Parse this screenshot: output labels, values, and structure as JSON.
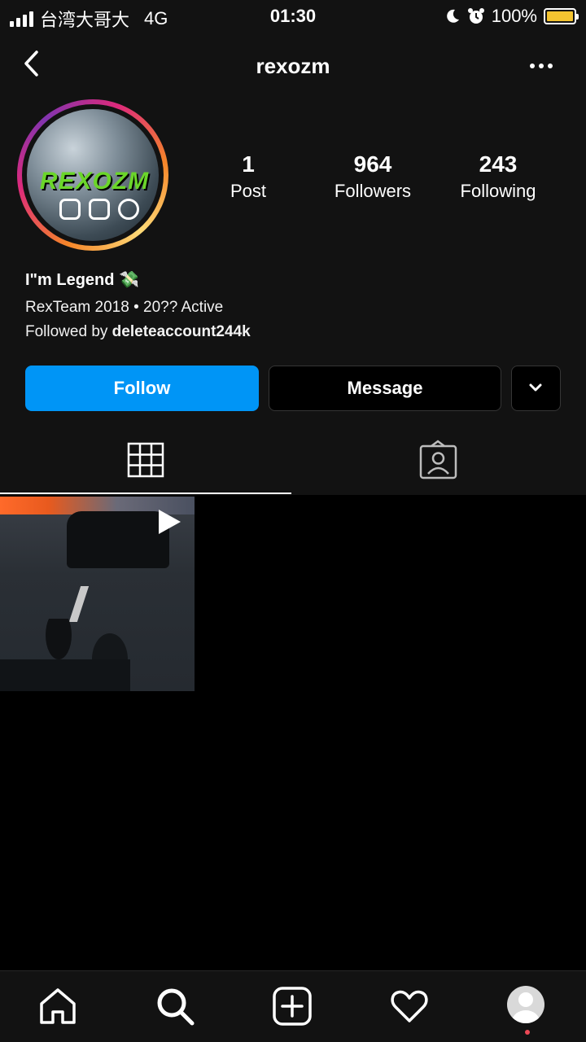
{
  "status_bar": {
    "carrier": "台湾大哥大",
    "network": "4G",
    "time": "01:30",
    "battery": "100%",
    "battery_fill_fraction": 1.0
  },
  "header": {
    "username": "rexozm",
    "back_icon": "chevron-left-icon",
    "more_icon": "ellipsis-icon"
  },
  "profile": {
    "avatar_logo_text": "REXOZM",
    "stats": [
      {
        "value": "1",
        "label": "Post"
      },
      {
        "value": "964",
        "label": "Followers"
      },
      {
        "value": "243",
        "label": "Following"
      }
    ],
    "bio": {
      "name": "I\"m Legend 💸",
      "line": "RexTeam 2018 • 20?? Active",
      "followed_by_prefix": "Followed by",
      "followed_by_user": "deleteaccount244k"
    }
  },
  "actions": {
    "follow_label": "Follow",
    "message_label": "Message",
    "dropdown_icon": "chevron-down-icon"
  },
  "tabs": [
    {
      "name": "grid",
      "icon": "grid-icon",
      "active": true
    },
    {
      "name": "tagged",
      "icon": "tagged-person-icon",
      "active": false
    }
  ],
  "posts": [
    {
      "type": "video",
      "icon": "play-icon"
    }
  ],
  "bottom_nav": [
    {
      "name": "home",
      "icon": "home-icon"
    },
    {
      "name": "search",
      "icon": "search-icon"
    },
    {
      "name": "add",
      "icon": "add-post-icon"
    },
    {
      "name": "activity",
      "icon": "heart-icon"
    },
    {
      "name": "profile",
      "icon": "profile-avatar-icon"
    }
  ],
  "colors": {
    "follow_button": "#0095f6",
    "background": "#121212",
    "avatar_ring_start": "#f58529",
    "avatar_ring_end": "#8134af",
    "notification_dot": "#ed4956"
  }
}
